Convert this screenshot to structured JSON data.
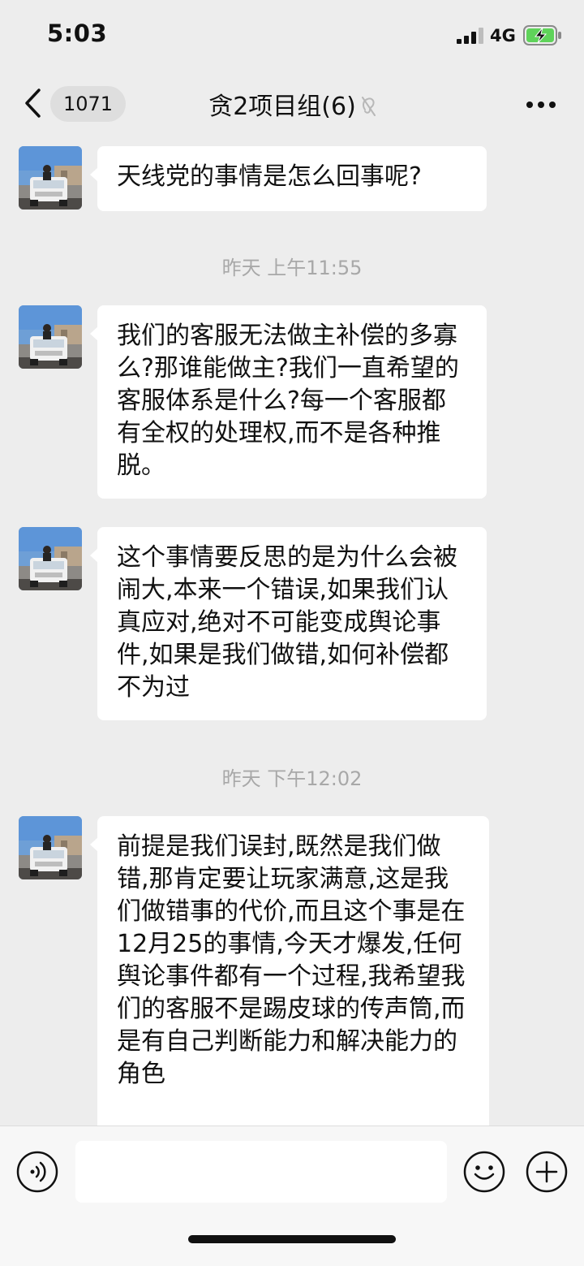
{
  "status_bar": {
    "time": "5:03",
    "network": "4G"
  },
  "nav": {
    "unread_count": "1071",
    "title": "贪2项目组(6)"
  },
  "messages": [
    {
      "type": "text",
      "text": "天线党的事情是怎么回事呢?"
    },
    {
      "type": "timestamp",
      "text": "昨天 上午11:55"
    },
    {
      "type": "text",
      "text": "我们的客服无法做主补偿的多寡么?那谁能做主?我们一直希望的客服体系是什么?每一个客服都有全权的处理权,而不是各种推脱。"
    },
    {
      "type": "text",
      "text": "这个事情要反思的是为什么会被闹大,本来一个错误,如果我们认真应对,绝对不可能变成舆论事件,如果是我们做错,如何补偿都不为过"
    },
    {
      "type": "timestamp",
      "text": "昨天 下午12:02"
    },
    {
      "type": "text",
      "text": "前提是我们误封,既然是我们做错,那肯定要让玩家满意,这是我们做错事的代价,而且这个事是在12月25的事情,今天才爆发,任何舆论事件都有一个过程,我希望我们的客服不是踢皮球的传声筒,而是有自己判断能力和解决能力的角色"
    }
  ],
  "input": {
    "placeholder": ""
  },
  "icons": {
    "back": "chevron-left-icon",
    "mute": "mute-ear-icon",
    "more": "more-dots-icon",
    "voice": "voice-icon",
    "emoji": "emoji-icon",
    "plus": "plus-icon",
    "signal": "signal-icon",
    "battery": "battery-charging-icon"
  },
  "colors": {
    "background": "#ededed",
    "bubble": "#ffffff",
    "battery_fill": "#5fd35a"
  }
}
